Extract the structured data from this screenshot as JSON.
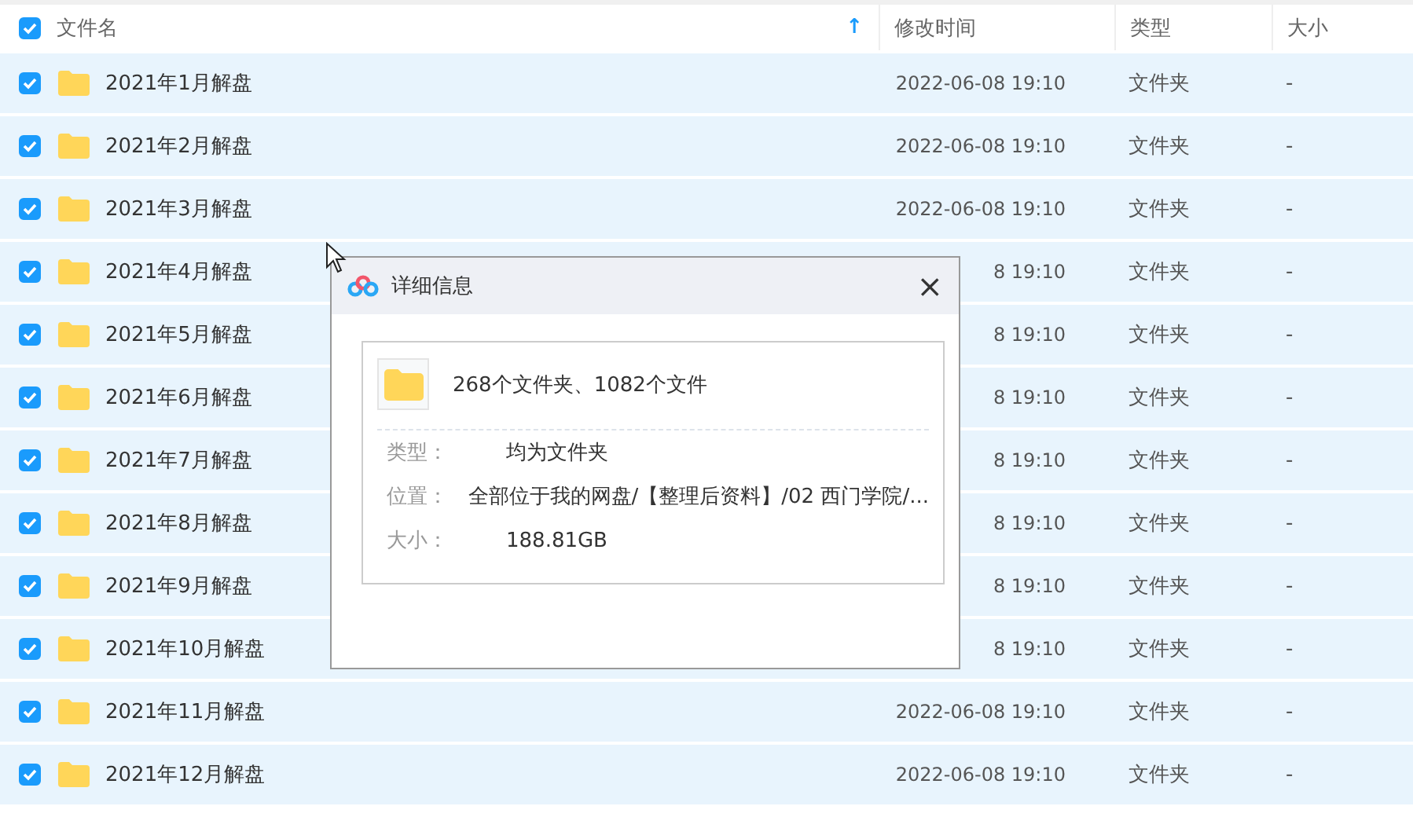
{
  "table": {
    "select_all": {
      "checked": true
    },
    "sort_arrow": "↑",
    "columns": [
      "文件名",
      "修改时间",
      "类型",
      "大小"
    ],
    "rows": [
      {
        "name": "2021年1月解盘",
        "modified": "2022-06-08 19:10",
        "type": "文件夹",
        "size": "-",
        "checked": true
      },
      {
        "name": "2021年2月解盘",
        "modified": "2022-06-08 19:10",
        "type": "文件夹",
        "size": "-",
        "checked": true
      },
      {
        "name": "2021年3月解盘",
        "modified": "2022-06-08 19:10",
        "type": "文件夹",
        "size": "-",
        "checked": true
      },
      {
        "name": "2021年4月解盘",
        "modified": "8 19:10",
        "type": "文件夹",
        "size": "-",
        "checked": true
      },
      {
        "name": "2021年5月解盘",
        "modified": "8 19:10",
        "type": "文件夹",
        "size": "-",
        "checked": true
      },
      {
        "name": "2021年6月解盘",
        "modified": "8 19:10",
        "type": "文件夹",
        "size": "-",
        "checked": true
      },
      {
        "name": "2021年7月解盘",
        "modified": "8 19:10",
        "type": "文件夹",
        "size": "-",
        "checked": true
      },
      {
        "name": "2021年8月解盘",
        "modified": "8 19:10",
        "type": "文件夹",
        "size": "-",
        "checked": true
      },
      {
        "name": "2021年9月解盘",
        "modified": "8 19:10",
        "type": "文件夹",
        "size": "-",
        "checked": true
      },
      {
        "name": "2021年10月解盘",
        "modified": "8 19:10",
        "type": "文件夹",
        "size": "-",
        "checked": true
      },
      {
        "name": "2021年11月解盘",
        "modified": "2022-06-08 19:10",
        "type": "文件夹",
        "size": "-",
        "checked": true
      },
      {
        "name": "2021年12月解盘",
        "modified": "2022-06-08 19:10",
        "type": "文件夹",
        "size": "-",
        "checked": true
      }
    ]
  },
  "dialog": {
    "title": "详细信息",
    "close": "×",
    "summary": "268个文件夹、1082个文件",
    "details": [
      {
        "label": "类型：",
        "value": "均为文件夹"
      },
      {
        "label": "位置：",
        "value": "全部位于我的网盘/【整理后资料】/02 西门学院/..."
      },
      {
        "label": "大小：",
        "value": "188.81GB"
      }
    ]
  }
}
